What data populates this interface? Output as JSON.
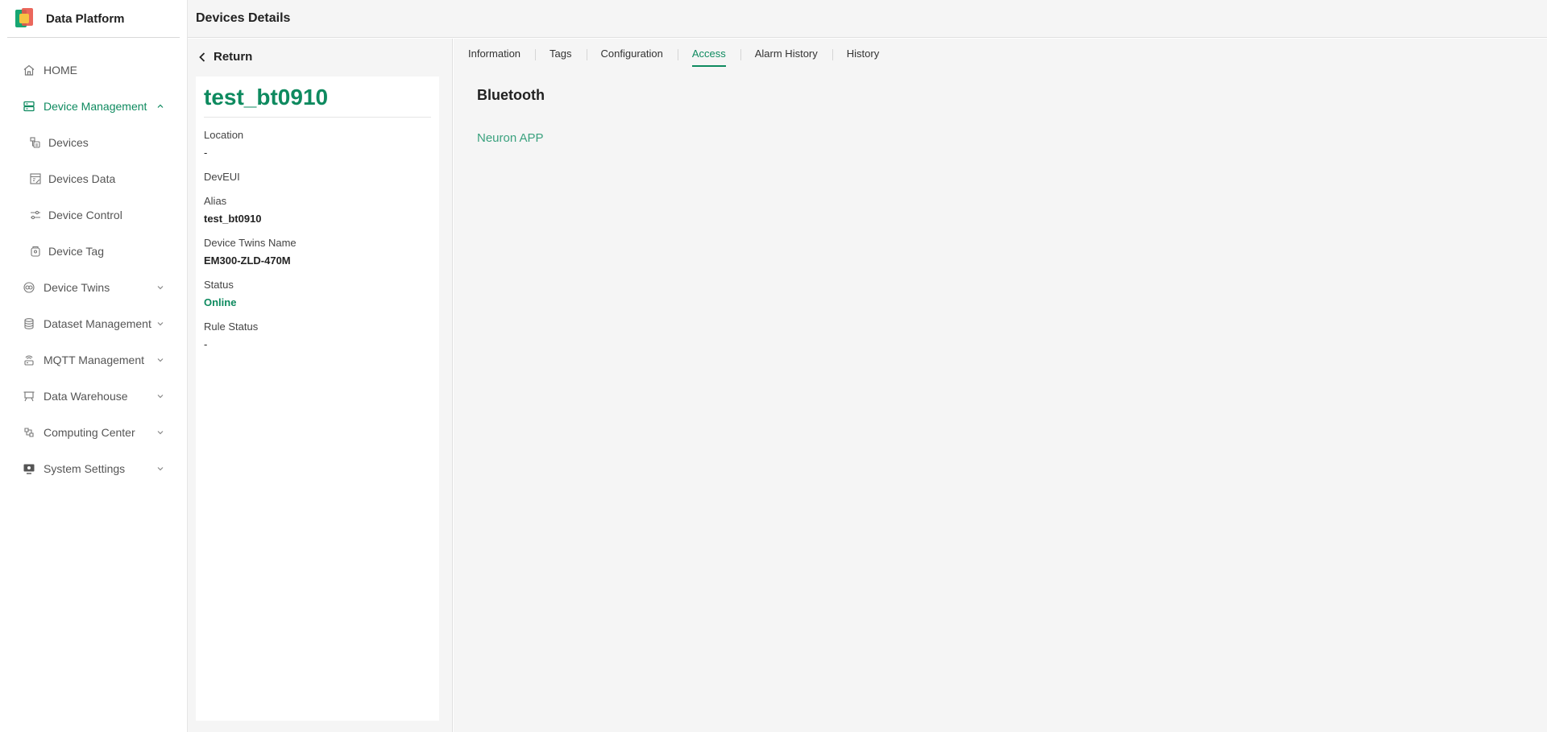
{
  "brand": {
    "name": "Data Platform"
  },
  "header": {
    "title": "Devices Details"
  },
  "sidebar": {
    "items": [
      {
        "label": "HOME"
      },
      {
        "label": "Device Management"
      },
      {
        "label": "Devices"
      },
      {
        "label": "Devices Data"
      },
      {
        "label": "Device Control"
      },
      {
        "label": "Device Tag"
      },
      {
        "label": "Device Twins"
      },
      {
        "label": "Dataset Management"
      },
      {
        "label": "MQTT Management"
      },
      {
        "label": "Data Warehouse"
      },
      {
        "label": "Computing Center"
      },
      {
        "label": "System Settings"
      }
    ]
  },
  "detail": {
    "return_label": "Return",
    "device_name": "test_bt0910",
    "fields": [
      {
        "label": "Location",
        "value": "-"
      },
      {
        "label": "DevEUI",
        "value": ""
      },
      {
        "label": "Alias",
        "value": "test_bt0910"
      },
      {
        "label": "Device Twins Name",
        "value": "EM300-ZLD-470M"
      },
      {
        "label": "Status",
        "value": "Online"
      },
      {
        "label": "Rule Status",
        "value": "-"
      }
    ]
  },
  "tabs": [
    {
      "label": "Information"
    },
    {
      "label": "Tags"
    },
    {
      "label": "Configuration"
    },
    {
      "label": "Access"
    },
    {
      "label": "Alarm History"
    },
    {
      "label": "History"
    }
  ],
  "access": {
    "section_title": "Bluetooth",
    "link_label": "Neuron APP"
  },
  "colors": {
    "accent": "#0e8a5f",
    "link": "#3aa17e"
  }
}
